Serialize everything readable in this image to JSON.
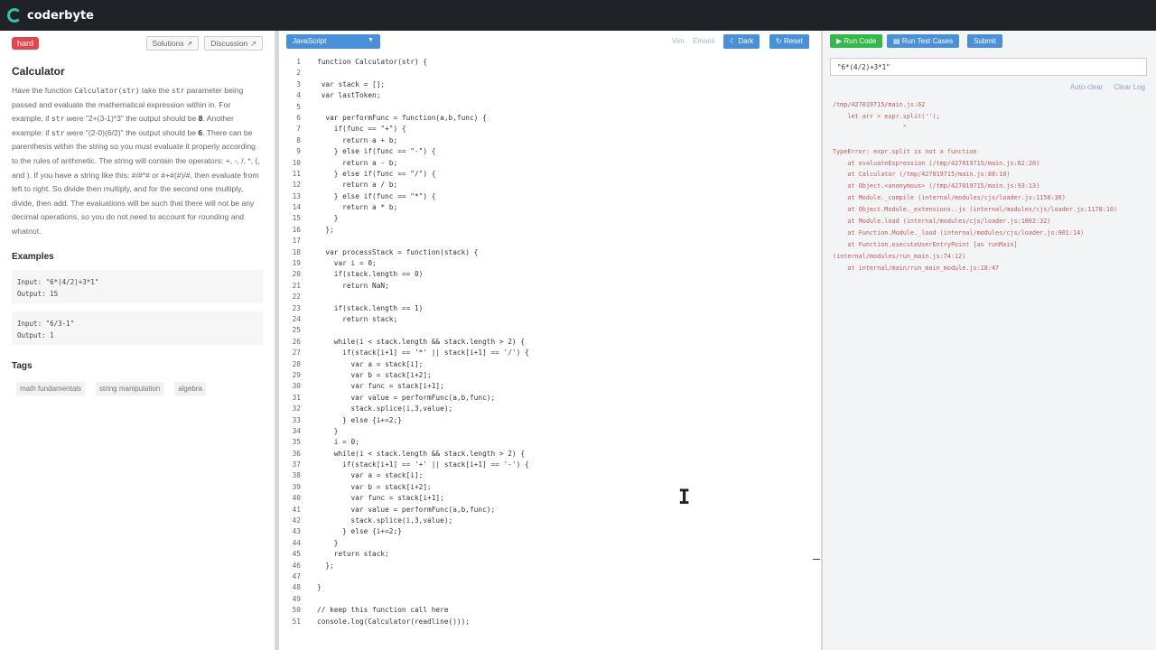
{
  "app": {
    "logo_text": "coderbyte"
  },
  "problem": {
    "difficulty": "hard",
    "solutions_label": "Solutions",
    "discussion_label": "Discussion",
    "title": "Calculator",
    "desc": {
      "p1": "Have the function ",
      "fn": "Calculator(str)",
      "p2": " take the ",
      "arg": "str",
      "p3": " parameter being passed and evaluate the mathematical expression within in. For example, if ",
      "arg2": "str",
      "p4": " were \"2+(3-1)*3\" the output should be ",
      "out1": "8",
      "p5": ". Another example: if ",
      "arg3": "str",
      "p6": " were \"(2-0)(6/2)\" the output should be ",
      "out2": "6",
      "p7": ". There can be parenthesis within the string so you must evaluate it properly according to the rules of arithmetic. The string will contain the operators: +, -, /, *, (, and ). If you have a string like this: #/#*# or #+#(#)/#, then evaluate from left to right. So divide then multiply, and for the second one multiply, divide, then add. The evaluations will be such that there will not be any decimal operations, so you do not need to account for rounding and whatnot."
    },
    "examples_heading": "Examples",
    "examples": [
      {
        "input": "Input: \"6*(4/2)+3*1\"",
        "output": "Output: 15"
      },
      {
        "input": "Input: \"6/3-1\"",
        "output": "Output: 1"
      }
    ],
    "tags_heading": "Tags",
    "tags": [
      "math fundamentals",
      "string manipulation",
      "algebra"
    ]
  },
  "editor": {
    "language": "JavaScript",
    "vim_label": "Vim",
    "emacs_label": "Emacs",
    "dark_label": "Dark",
    "reset_label": "Reset",
    "lines": [
      "function Calculator(str) {",
      "",
      " var stack = [];",
      " var lastToken;",
      "",
      "  var performFunc = function(a,b,func) {",
      "    if(func == \"+\") {",
      "      return a + b;",
      "    } else if(func == \"-\") {",
      "      return a - b;",
      "    } else if(func == \"/\") {",
      "      return a / b;",
      "    } else if(func == \"*\") {",
      "      return a * b;",
      "    }",
      "  };",
      "",
      "  var processStack = function(stack) {",
      "    var i = 0;",
      "    if(stack.length == 0)",
      "      return NaN;",
      "",
      "    if(stack.length == 1)",
      "      return stack;",
      "",
      "    while(i < stack.length && stack.length > 2) {",
      "      if(stack[i+1] == '*' || stack[i+1] == '/') {",
      "        var a = stack[i];",
      "        var b = stack[i+2];",
      "        var func = stack[i+1];",
      "        var value = performFunc(a,b,func);",
      "        stack.splice(i,3,value);",
      "      } else {i+=2;}",
      "    }",
      "    i = 0;",
      "    while(i < stack.length && stack.length > 2) {",
      "      if(stack[i+1] == '+' || stack[i+1] == '-') {",
      "        var a = stack[i];",
      "        var b = stack[i+2];",
      "        var func = stack[i+1];",
      "        var value = performFunc(a,b,func);",
      "        stack.splice(i,3,value);",
      "      } else {i+=2;}",
      "    }",
      "    return stack;",
      "  };",
      "",
      "}",
      "",
      "// keep this function call here",
      "console.log(Calculator(readline()));"
    ]
  },
  "runner": {
    "run_label": "Run Code",
    "tests_label": "Run Test Cases",
    "submit_label": "Submit",
    "input_value": "\"6*(4/2)+3*1\"",
    "autoclear_label": "Auto-clear",
    "clearlog_label": "Clear Log",
    "console_lines": [
      "/tmp/427019715/main.js:62",
      "    let arr = expr.split('');",
      "                   ^",
      "",
      "TypeError: expr.split is not a function",
      "    at evaluateExpression (/tmp/427019715/main.js:62:20)",
      "    at Calculator (/tmp/427019715/main.js:88:10)",
      "    at Object.<anonymous> (/tmp/427019715/main.js:93:13)",
      "    at Module._compile (internal/modules/cjs/loader.js:1158:30)",
      "    at Object.Module._extensions..js (internal/modules/cjs/loader.js:1178:10)",
      "    at Module.load (internal/modules/cjs/loader.js:1002:32)",
      "    at Function.Module._load (internal/modules/cjs/loader.js:901:14)",
      "    at Function.executeUserEntryPoint [as runMain]",
      "(internal/modules/run_main.js:74:12)",
      "    at internal/main/run_main_module.js:18:47"
    ]
  }
}
